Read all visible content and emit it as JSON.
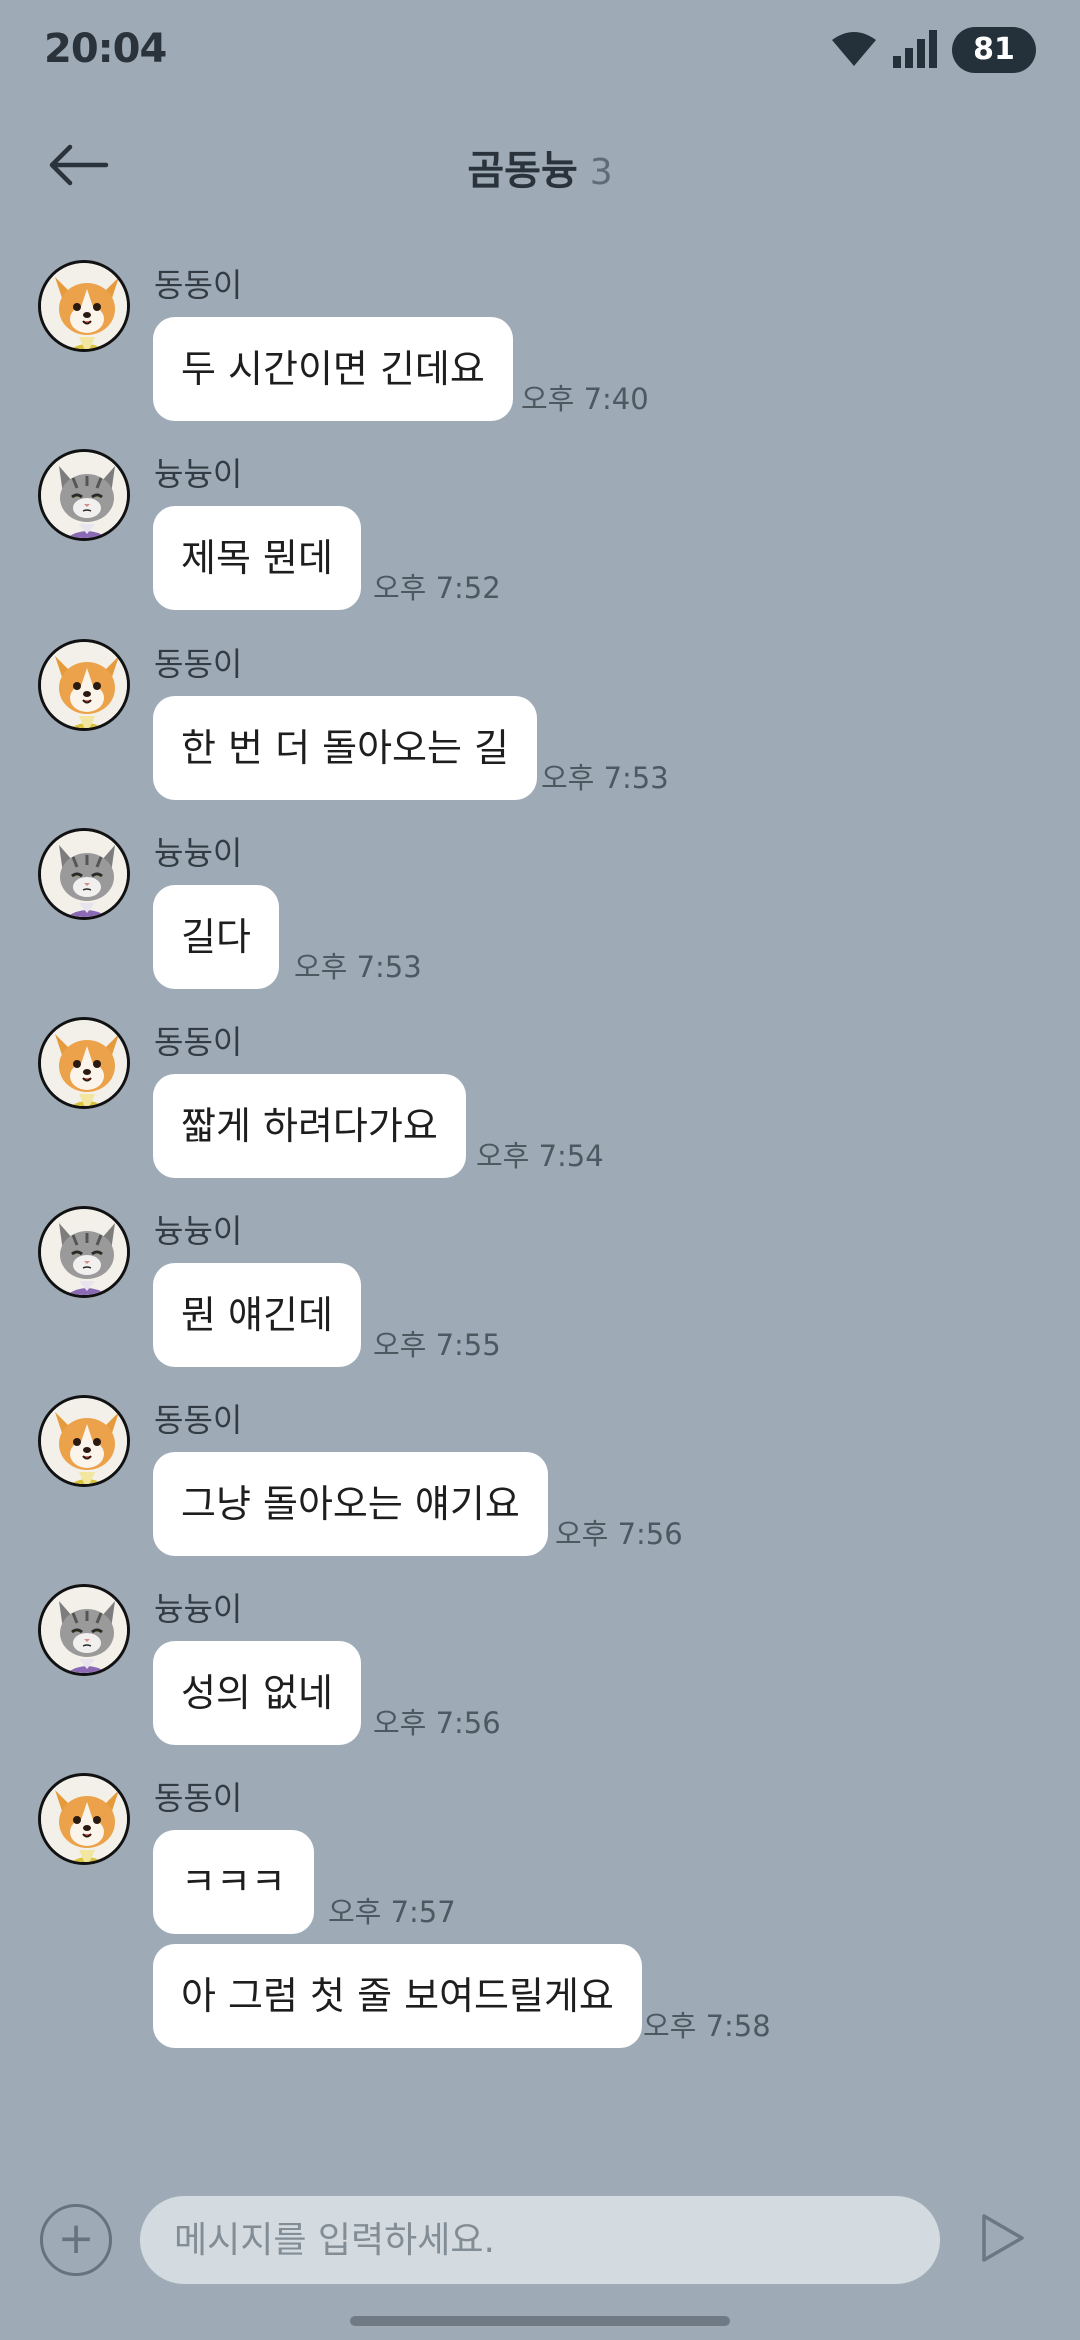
{
  "status_bar": {
    "time": "20:04",
    "battery": "81"
  },
  "header": {
    "title": "곰동늉",
    "member_count": "3"
  },
  "messages": [
    {
      "sender": "동동이",
      "avatar": "dog",
      "text": "두 시간이면 긴데요",
      "time": "오후 7:40"
    },
    {
      "sender": "늉늉이",
      "avatar": "cat",
      "text": "제목 뭔데",
      "time": "오후 7:52"
    },
    {
      "sender": "동동이",
      "avatar": "dog",
      "text": "한 번 더 돌아오는 길",
      "time": "오후 7:53"
    },
    {
      "sender": "늉늉이",
      "avatar": "cat",
      "text": "길다",
      "time": "오후 7:53"
    },
    {
      "sender": "동동이",
      "avatar": "dog",
      "text": "짧게 하려다가요",
      "time": "오후 7:54"
    },
    {
      "sender": "늉늉이",
      "avatar": "cat",
      "text": "뭔 얘긴데",
      "time": "오후 7:55"
    },
    {
      "sender": "동동이",
      "avatar": "dog",
      "text": "그냥 돌아오는 얘기요",
      "time": "오후 7:56"
    },
    {
      "sender": "늉늉이",
      "avatar": "cat",
      "text": "성의 없네",
      "time": "오후 7:56"
    },
    {
      "sender": "동동이",
      "avatar": "dog",
      "text": "ㅋㅋㅋ",
      "time": "오후 7:57"
    },
    {
      "sender": "",
      "avatar": "",
      "text": "아 그럼 첫 줄 보여드릴게요",
      "time": "오후 7:58"
    }
  ],
  "input": {
    "placeholder": "메시지를 입력하세요."
  },
  "colors": {
    "background": "#9eabb6",
    "bubble": "#ffffff",
    "input": "#d3dbe1"
  }
}
